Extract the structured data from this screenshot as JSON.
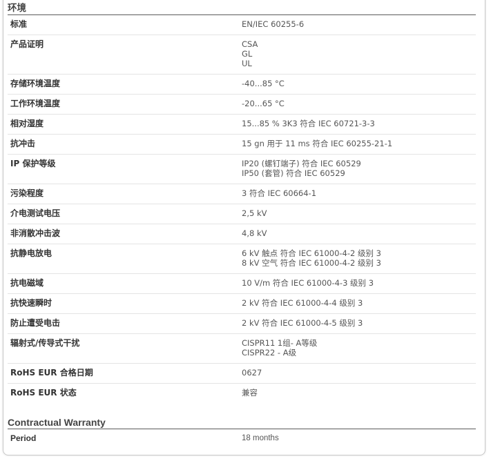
{
  "sections": [
    {
      "title": "环境",
      "rows": [
        {
          "label": "标准",
          "values": [
            "EN/IEC 60255-6"
          ]
        },
        {
          "label": "产品证明",
          "values": [
            "CSA",
            "GL",
            "UL"
          ]
        },
        {
          "label": "存储环境温度",
          "values": [
            "-40...85 °C"
          ]
        },
        {
          "label": "工作环境温度",
          "values": [
            "-20...65 °C"
          ]
        },
        {
          "label": "相对湿度",
          "values": [
            "15...85 % 3K3 符合 IEC 60721-3-3"
          ]
        },
        {
          "label": "抗冲击",
          "values": [
            "15 gn 用于 11 ms 符合 IEC 60255-21-1"
          ]
        },
        {
          "label": "IP 保护等级",
          "values": [
            "IP20 (螺钉端子) 符合 IEC 60529",
            "IP50 (套管) 符合 IEC 60529"
          ]
        },
        {
          "label": "污染程度",
          "values": [
            "3 符合 IEC 60664-1"
          ]
        },
        {
          "label": "介电测试电压",
          "values": [
            "2,5 kV"
          ]
        },
        {
          "label": "非消散冲击波",
          "values": [
            "4,8 kV"
          ]
        },
        {
          "label": "抗静电放电",
          "values": [
            "6 kV 触点 符合 IEC 61000-4-2 级别 3",
            "8 kV 空气 符合 IEC 61000-4-2 级别 3"
          ]
        },
        {
          "label": "抗电磁域",
          "values": [
            "10 V/m 符合 IEC 61000-4-3 级别 3"
          ]
        },
        {
          "label": "抗快速瞬时",
          "values": [
            "2 kV 符合 IEC 61000-4-4 级别 3"
          ]
        },
        {
          "label": "防止遭受电击",
          "values": [
            "2 kV 符合 IEC 61000-4-5 级别 3"
          ]
        },
        {
          "label": "辐射式/传导式干扰",
          "values": [
            "CISPR11 1组- A等级",
            "CISPR22 - A级"
          ]
        },
        {
          "label": "RoHS EUR 合格日期",
          "values": [
            "0627"
          ]
        },
        {
          "label": "RoHS EUR 状态",
          "values": [
            "兼容"
          ]
        }
      ]
    },
    {
      "title": "Contractual Warranty",
      "rows": [
        {
          "label": "Period",
          "values": [
            "18 months"
          ]
        }
      ]
    }
  ]
}
